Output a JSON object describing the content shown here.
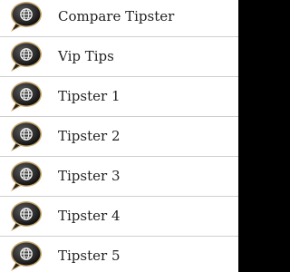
{
  "menu": {
    "items": [
      {
        "label": "Compare Tipster",
        "icon": "globe-speech-bubble-icon"
      },
      {
        "label": "Vip Tips",
        "icon": "globe-speech-bubble-icon"
      },
      {
        "label": "Tipster 1",
        "icon": "globe-speech-bubble-icon"
      },
      {
        "label": "Tipster 2",
        "icon": "globe-speech-bubble-icon"
      },
      {
        "label": "Tipster 3",
        "icon": "globe-speech-bubble-icon"
      },
      {
        "label": "Tipster 4",
        "icon": "globe-speech-bubble-icon"
      },
      {
        "label": "Tipster 5",
        "icon": "globe-speech-bubble-icon"
      }
    ]
  },
  "colors": {
    "list_background": "#ffffff",
    "divider": "#cfcfcf",
    "panel_background": "#000000",
    "icon_bubble": "#2e2e2e",
    "icon_rim": "#c8a66a",
    "label_text": "#222222"
  }
}
